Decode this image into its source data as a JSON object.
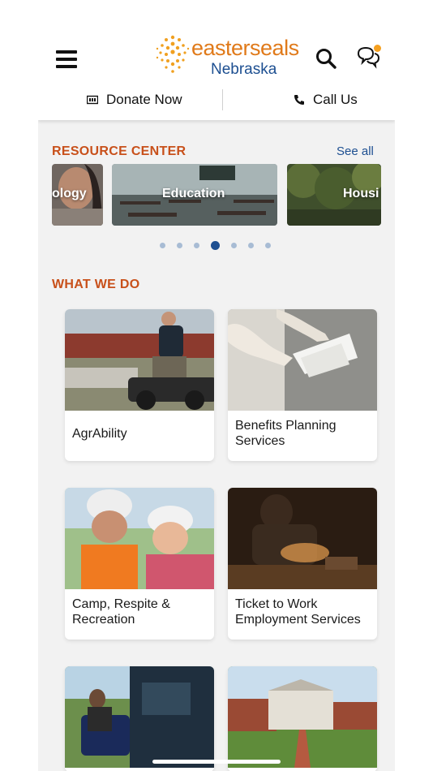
{
  "header": {
    "menu_icon": "hamburger-menu-icon",
    "logo": {
      "word": "easterseals",
      "sub": "Nebraska",
      "word_color": "#e07a1a",
      "sub_color": "#1d4f91"
    },
    "search_icon": "search-icon",
    "chat_icon": "chat-bubbles-icon",
    "notification_color": "#f5a020"
  },
  "actions": {
    "donate_label": "Donate Now",
    "donate_icon": "money-icon",
    "call_label": "Call Us",
    "call_icon": "phone-icon"
  },
  "resource_center": {
    "title": "RESOURCE CENTER",
    "see_all": "See all",
    "cards": [
      {
        "label": "ology"
      },
      {
        "label": "Education"
      },
      {
        "label": "Housi"
      }
    ],
    "dots_count": 7,
    "active_dot": 4
  },
  "what_we_do": {
    "title": "WHAT WE DO",
    "tiles": [
      {
        "label": "AgrAbility"
      },
      {
        "label": "Benefits Planning Services"
      },
      {
        "label": "Camp, Respite & Recreation"
      },
      {
        "label": "Ticket to Work Employment Services"
      },
      {
        "label": ""
      },
      {
        "label": ""
      }
    ]
  },
  "colors": {
    "accent_orange": "#c8501a",
    "brand_blue": "#1d4f91"
  }
}
